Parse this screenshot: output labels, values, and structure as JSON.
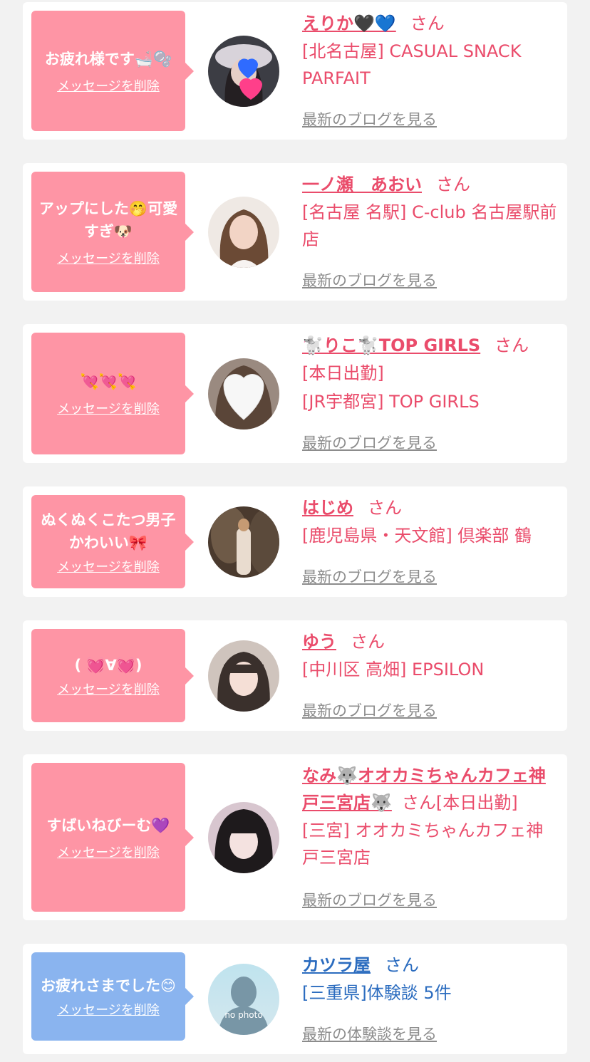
{
  "colors": {
    "pink_bubble": "#fe95a5",
    "blue_bubble": "#8ab4ef",
    "pink_text": "#ea4c6b",
    "blue_text": "#2b6cbf",
    "link_gray": "#8c8c8c",
    "card_bg": "#ffffff",
    "page_bg": "#f2f2f2"
  },
  "items": [
    {
      "message": "お疲れ様です🛁🫧",
      "delete_label": "メッセージを削除",
      "name": "えりか🖤💙",
      "honorific": "さん",
      "shop": "[北名古屋] CASUAL SNACK PARFAIT",
      "blog_link": "最新のブログを見る",
      "avatar": "avatar-photo-hearts"
    },
    {
      "message": "アップにした🤭可愛すぎ🐶",
      "delete_label": "メッセージを削除",
      "name": "一ノ瀬　あおい",
      "honorific": "さん",
      "shop": "[名古屋 名駅] C-club 名古屋駅前店",
      "blog_link": "最新のブログを見る",
      "avatar": "avatar-photo-woman"
    },
    {
      "message": "💘💘💘",
      "delete_label": "メッセージを削除",
      "name": "🐩りこ🐩TOP GIRLS",
      "honorific": "さん",
      "status": "[本日出勤]",
      "shop": "[JR宇都宮] TOP GIRLS",
      "blog_link": "最新のブログを見る",
      "avatar": "avatar-photo-white-heart"
    },
    {
      "message": "ぬくぬくこたつ男子かわいい🎀",
      "delete_label": "メッセージを削除",
      "name": "はじめ",
      "honorific": "さん",
      "shop": "[鹿児島県・天文館] 倶楽部 鶴",
      "blog_link": "最新のブログを見る",
      "avatar": "avatar-photo-cave"
    },
    {
      "message": "( 💓∀💓)",
      "delete_label": "メッセージを削除",
      "name": "ゆう",
      "honorific": "さん",
      "shop": "[中川区 高畑] EPSILON",
      "blog_link": "最新のブログを見る",
      "avatar": "avatar-photo-girl"
    },
    {
      "message": "すばいねびーむ💜",
      "delete_label": "メッセージを削除",
      "name": "なみ🐺オオカミちゃんカフェ神戸三宮店🐺",
      "honorific": "さん",
      "status": "[本日出勤]",
      "shop": "[三宮] オオカミちゃんカフェ神戸三宮店",
      "blog_link": "最新のブログを見る",
      "avatar": "avatar-photo-dark-hair"
    },
    {
      "message": "お疲れさまでした😊",
      "delete_label": "メッセージを削除",
      "name": "カツラ屋",
      "honorific": "さん",
      "shop": "[三重県]体験談 5件",
      "blog_link": "最新の体験談を見る",
      "avatar": "no-photo-avatar",
      "avatar_text": "no photo"
    }
  ]
}
